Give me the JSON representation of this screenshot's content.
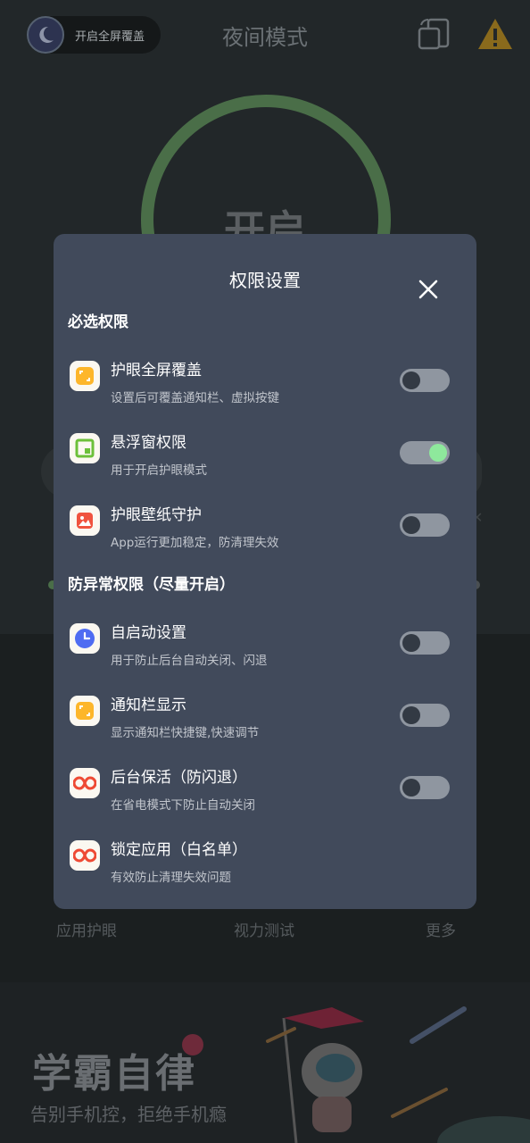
{
  "app": {
    "title": "夜间模式",
    "overlay_pill_label": "开启全屏覆盖",
    "main_toggle_text": "开启"
  },
  "bottom_tabs": [
    "应用护眼",
    "视力测试",
    "更多"
  ],
  "banner": {
    "title": "学霸自律",
    "subtitle": "告别手机控，拒绝手机瘾"
  },
  "dialog": {
    "title": "权限设置",
    "sections": [
      {
        "title": "必选权限",
        "items": [
          {
            "name": "护眼全屏覆盖",
            "desc": "设置后可覆盖通知栏、虚拟按键",
            "icon": "fullscreen-overlay-icon",
            "toggle": false
          },
          {
            "name": "悬浮窗权限",
            "desc": "用于开启护眼模式",
            "icon": "floating-window-icon",
            "toggle": true
          },
          {
            "name": "护眼壁纸守护",
            "desc": "App运行更加稳定，防清理失效",
            "icon": "wallpaper-icon",
            "toggle": false
          }
        ]
      },
      {
        "title": "防异常权限（尽量开启）",
        "items": [
          {
            "name": "自启动设置",
            "desc": "用于防止后台自动关闭、闪退",
            "icon": "clock-icon",
            "toggle": false
          },
          {
            "name": "通知栏显示",
            "desc": "显示通知栏快捷键,快速调节",
            "icon": "notification-icon",
            "toggle": false
          },
          {
            "name": "后台保活（防闪退）",
            "desc": "在省电模式下防止自动关闭",
            "icon": "infinity-icon",
            "toggle": false
          },
          {
            "name": "锁定应用（白名单）",
            "desc": "有效防止清理失效问题",
            "icon": "infinity-icon",
            "toggle": null
          }
        ]
      }
    ]
  },
  "colors": {
    "dialog_bg": "#414a5b",
    "toggle_on_knob": "#8ee89c",
    "ring_green": "#4a6e48"
  }
}
